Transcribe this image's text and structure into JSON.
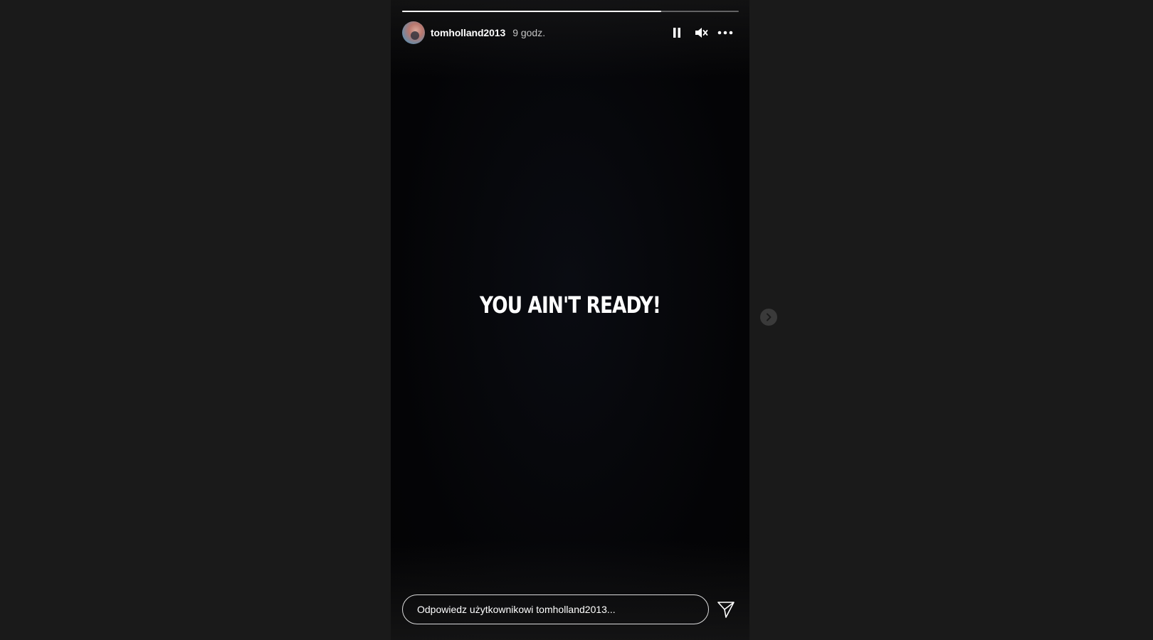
{
  "story": {
    "progress_fraction": 0.77,
    "user": {
      "username": "tomholland2013",
      "time_ago": "9 godz."
    },
    "controls": {
      "pause_icon": "pause-icon",
      "mute_icon": "volume-muted-icon",
      "more_icon": "more-options-icon"
    },
    "text": "YOU AIN'T READY!",
    "reply": {
      "placeholder": "Odpowiedz użytkownikowi tomholland2013...",
      "value": "",
      "send_icon": "paper-plane-icon"
    }
  },
  "navigation": {
    "next_icon": "chevron-right-icon"
  },
  "colors": {
    "page_background": "#1a1a1a",
    "story_background": "#050507",
    "text": "#ffffff"
  }
}
